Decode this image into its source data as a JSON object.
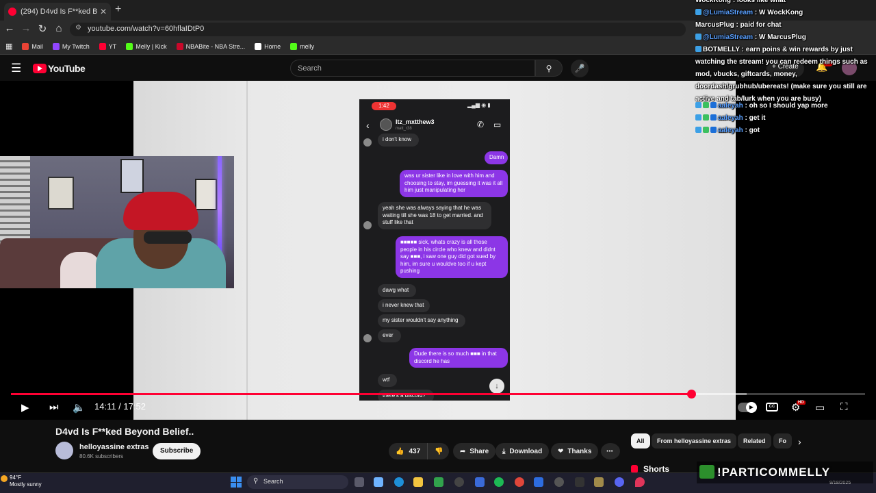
{
  "browser": {
    "tab_title": "(294) D4vd Is F**ked Beyond Be",
    "tab_close": "✕",
    "new_tab": "+",
    "url": "youtube.com/watch?v=60hflaIDtP0",
    "bookmarks": [
      {
        "label": "Mail",
        "color": "#ea4335"
      },
      {
        "label": "My Twitch",
        "color": "#9146ff"
      },
      {
        "label": "YT",
        "color": "#ff0033"
      },
      {
        "label": "Melly | Kick",
        "color": "#53fc18"
      },
      {
        "label": "NBABite - NBA Stre...",
        "color": "#c9082a"
      },
      {
        "label": "Home",
        "color": "#ffffff"
      },
      {
        "label": "melly",
        "color": "#53fc18"
      }
    ]
  },
  "youtube": {
    "logo_text": "YouTube",
    "search_placeholder": "Search",
    "create_label": "+ Create",
    "notif_count": "9+"
  },
  "phone": {
    "time": "1:42",
    "contact_name": "ltz_mxtthew3",
    "contact_handle": "matt_r38",
    "messages": [
      {
        "dir": "in",
        "text": "i don't know",
        "avatar": true
      },
      {
        "dir": "out",
        "text": "Damn"
      },
      {
        "dir": "out",
        "text": "was ur sister like in love with him and choosing to stay, im guessing it was it all him just manipulating her"
      },
      {
        "dir": "in",
        "text": "yeah she was always saying that he was waiting till she was 18 to get married. and stuff like that",
        "avatar": true
      },
      {
        "dir": "out",
        "text": "■■■■■ sick, whats crazy is all those people in his circle who knew and didnt say ■■■, i saw one guy did got sued by him, im sure u wouldve too if u kept pushing"
      },
      {
        "dir": "in",
        "text": "dawg what"
      },
      {
        "dir": "in",
        "text": "i never knew that"
      },
      {
        "dir": "in",
        "text": "my sister wouldn't say anything"
      },
      {
        "dir": "in",
        "text": "ever",
        "avatar": true
      },
      {
        "dir": "out",
        "text": "Dude there is so much ■■■ in that discord he has"
      },
      {
        "dir": "in",
        "text": "wtf"
      },
      {
        "dir": "in",
        "text": "there's a discord?",
        "avatar": true
      }
    ]
  },
  "player": {
    "time_display": "14:11 / 17:52",
    "progress_fraction": 0.7965
  },
  "video": {
    "title": "D4vd Is F**ked Beyond Belief..",
    "channel_name": "helloyassine extras",
    "subscribers": "80.6K subscribers",
    "subscribe_label": "Subscribe",
    "likes": "437",
    "share_label": "Share",
    "download_label": "Download",
    "thanks_label": "Thanks",
    "more_label": "⋯"
  },
  "chips": [
    "All",
    "From helloyassine extras",
    "Related",
    "Fo"
  ],
  "shorts_label": "Shorts",
  "chat": [
    {
      "name": "WockKong",
      "text": " : looks like what",
      "blue": false
    },
    {
      "name": "@LumiaStream",
      "text": " : W WockKong",
      "blue": true
    },
    {
      "name": "MarcusPlug",
      "text": " : paid for chat",
      "blue": false
    },
    {
      "name": "@LumiaStream",
      "text": " : W MarcusPlug",
      "blue": true
    },
    {
      "name": "BOTMELLY",
      "text": " : earn poins & win rewards by just watching the stream! you can redeem things such as mod, vbucks, giftcards, money, doordash/grubhub/ubereats! (make sure you still are active and tab/lurk when you are busy)",
      "blue": false
    },
    {
      "name": "aaleyah",
      "text": " : oh so I should yap more",
      "blue": true
    },
    {
      "name": "aaleyah",
      "text": " : get it",
      "blue": true
    },
    {
      "name": "aaleyah",
      "text": " : got",
      "blue": true
    }
  ],
  "promo_text": "!PARTICOMMELLY",
  "taskbar": {
    "temperature": "94°F",
    "condition": "Mostly sunny",
    "search_label": "Search",
    "date": "9/18/2025"
  }
}
